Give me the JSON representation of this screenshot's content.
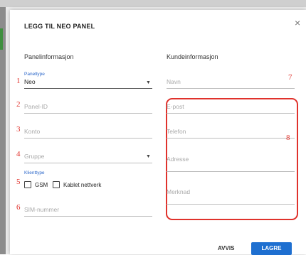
{
  "dialog": {
    "title": "LEGG TIL NEO PANEL",
    "close_symbol": "×"
  },
  "left": {
    "heading": "Panelinformasjon",
    "paneltype_label": "Paneltype",
    "paneltype_value": "Neo",
    "panel_id_placeholder": "Panel-ID",
    "konto_placeholder": "Konto",
    "gruppe_placeholder": "Gruppe",
    "klienttype_label": "Klienttype",
    "gsm_label": "GSM",
    "kablet_label": "Kablet nettverk",
    "sim_placeholder": "SIM-nummer"
  },
  "right": {
    "heading": "Kundeinformasjon",
    "navn_placeholder": "Navn",
    "epost_placeholder": "E-post",
    "telefon_placeholder": "Telefon",
    "adresse_placeholder": "Adresse",
    "merknad_placeholder": "Merknad"
  },
  "annotations": {
    "n1": "1",
    "n2": "2",
    "n3": "3",
    "n4": "4",
    "n5": "5",
    "n6": "6",
    "n7": "7",
    "n8": "8",
    "color": "#e0322c"
  },
  "footer": {
    "avvis_label": "AVVIS",
    "lagre_label": "LAGRE",
    "primary_color": "#1e6fd0"
  }
}
